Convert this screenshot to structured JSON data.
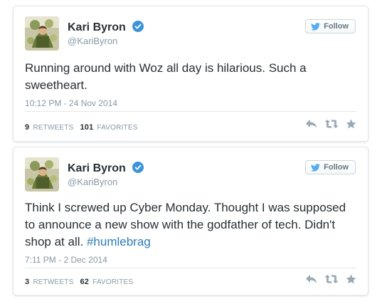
{
  "tweets": [
    {
      "name": "Kari Byron",
      "handle": "@KariByron",
      "follow_label": "Follow",
      "text": "Running around with Woz all day is hilarious.  Such a sweetheart.",
      "hashtag": "",
      "timestamp": "10:12 PM - 24 Nov 2014",
      "retweets_count": "9",
      "retweets_label": "RETWEETS",
      "favorites_count": "101",
      "favorites_label": "FAVORITES"
    },
    {
      "name": "Kari Byron",
      "handle": "@KariByron",
      "follow_label": "Follow",
      "text": "Think I screwed up Cyber Monday.  Thought I  was supposed to announce a new show with the godfather of tech.  Didn't shop at all. ",
      "hashtag": "#humlebrag",
      "timestamp": "7:11 PM - 2 Dec 2014",
      "retweets_count": "3",
      "retweets_label": "RETWEETS",
      "favorites_count": "62",
      "favorites_label": "FAVORITES"
    }
  ],
  "colors": {
    "verified": "#3b94d9",
    "follow_bird": "#55acee",
    "hashtag": "#2b7bb9",
    "action_icon": "#99a9b5"
  },
  "icons": [
    "verified-badge-icon",
    "twitter-bird-icon",
    "reply-icon",
    "retweet-icon",
    "favorite-star-icon"
  ]
}
